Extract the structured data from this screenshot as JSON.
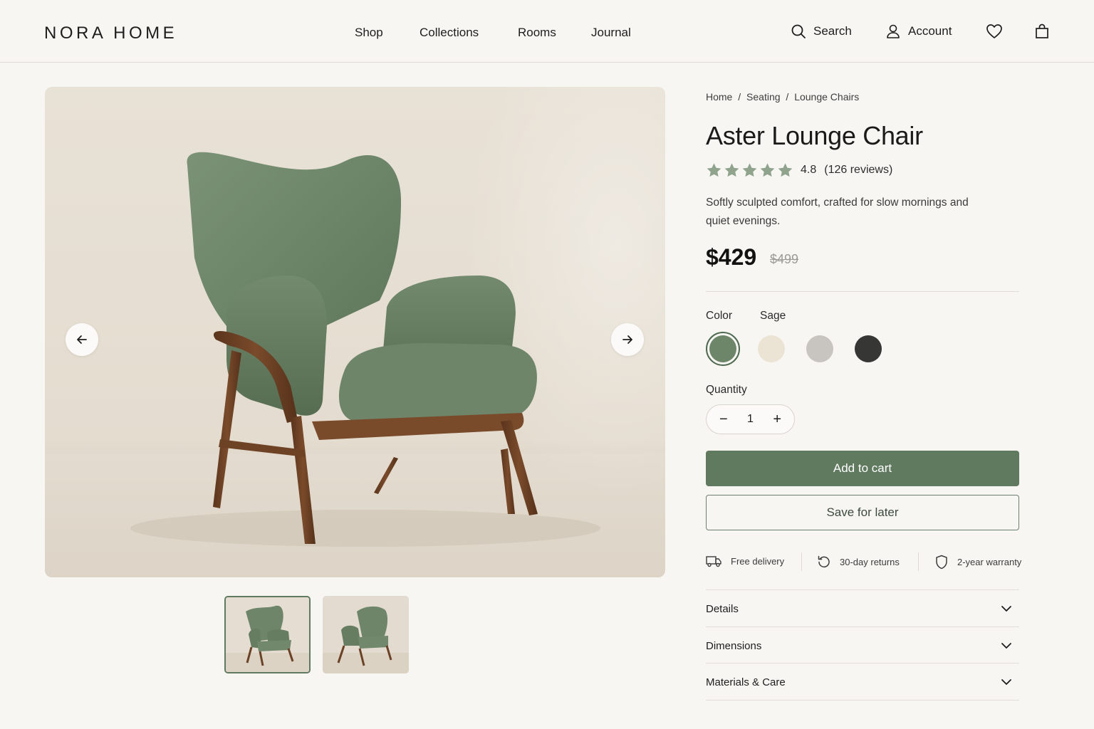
{
  "brand": {
    "logo": "NORA HOME"
  },
  "nav": {
    "items": [
      "Shop",
      "Collections",
      "Rooms",
      "Journal"
    ]
  },
  "utility": {
    "search": "Search",
    "account": "Account",
    "wishlist_icon": "heart-icon",
    "cart_icon": "bag-icon"
  },
  "breadcrumb": [
    "Home",
    "/",
    "Seating",
    "/",
    "Lounge Chairs"
  ],
  "product": {
    "title": "Aster Lounge Chair",
    "rating": "4.8",
    "rating_value": 4.8,
    "stars_filled": 5,
    "reviews": "(126 reviews)",
    "description": "Softly sculpted comfort, crafted for slow mornings and quiet evenings.",
    "price": "$429",
    "old_price": "$499"
  },
  "color": {
    "label": "Color",
    "selected": "Sage",
    "swatches": [
      {
        "name": "Sage",
        "hex": "#6d8669"
      },
      {
        "name": "Cream",
        "hex": "#ebe3d3"
      },
      {
        "name": "Stone",
        "hex": "#c8c4bf"
      },
      {
        "name": "Charcoal",
        "hex": "#363635"
      }
    ]
  },
  "quantity": {
    "label": "Quantity",
    "value": "1",
    "minus": "−",
    "plus": "+"
  },
  "actions": {
    "add_to_cart": "Add to cart",
    "save_for_later": "Save for later"
  },
  "perks": [
    "Free delivery",
    "30-day returns",
    "2-year warranty"
  ],
  "accordion": [
    "Details",
    "Dimensions",
    "Materials & Care"
  ],
  "colors": {
    "accent": "#5f7a5f",
    "background": "#f8f6f3",
    "star": "#8fa38d",
    "wood": "#6b4226"
  }
}
